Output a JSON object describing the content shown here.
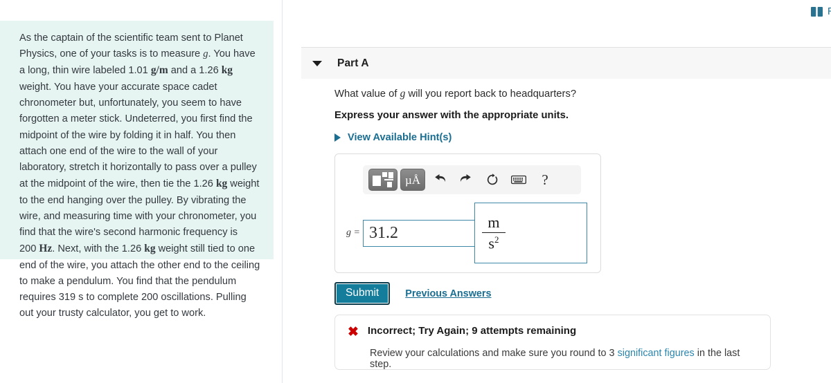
{
  "topbar": {
    "review_label": "Re",
    "review_icon": "book-icon"
  },
  "problem": {
    "paragraph": "As the captain of the scientific team sent to Planet Physics, one of your tasks is to measure g. You have a long, thin wire labeled 1.01 g/m and a 1.26 kg weight. You have your accurate space cadet chronometer but, unfortunately, you seem to have forgotten a meter stick. Undeterred, you first find the midpoint of the wire by folding it in half. You then attach one end of the wire to the wall of your laboratory, stretch it horizontally to pass over a pulley at the midpoint of the wire, then tie the 1.26 kg weight to the end hanging over the pulley. By vibrating the wire, and measuring time with your chronometer, you find that the wire's second harmonic frequency is 200 Hz. Next, with the 1.26 kg weight still tied to one end of the wire, you attach the other end to the ceiling to make a pendulum. You find that the pendulum requires 319 s to complete 200 oscillations. Pulling out your trusty calculator, you get to work.",
    "background_color": "#e6f4f2",
    "values": {
      "linear_density": "1.01 g/m",
      "mass": "1.26 kg",
      "second_harmonic": "200 Hz",
      "pendulum_time": "319 s",
      "oscillations": "200"
    }
  },
  "part": {
    "title": "Part A",
    "caret_icon": "chevron-down-icon",
    "question": "What value of g will you report back to headquarters?",
    "instruction": "Express your answer with the appropriate units.",
    "hint_label": "View Available Hint(s)",
    "hint_icon": "chevron-right-icon"
  },
  "answer": {
    "variable_label": "g =",
    "value": "31.2",
    "units": {
      "numerator": "m",
      "denominator": "s",
      "denominator_exponent": "2"
    },
    "border_color": "#3f87a6",
    "toolbar": [
      {
        "name": "template-icon",
        "label": ""
      },
      {
        "name": "units-icon",
        "label": "µÅ"
      },
      {
        "name": "undo-icon",
        "label": ""
      },
      {
        "name": "redo-icon",
        "label": ""
      },
      {
        "name": "reset-icon",
        "label": ""
      },
      {
        "name": "keyboard-icon",
        "label": ""
      },
      {
        "name": "help-icon",
        "label": "?"
      }
    ]
  },
  "actions": {
    "submit_label": "Submit",
    "previous_answers_label": "Previous Answers",
    "submit_color": "#157d9c"
  },
  "feedback": {
    "icon": "x-mark-icon",
    "icon_color": "#cc0000",
    "title": "Incorrect; Try Again; 9 attempts remaining",
    "body_pre": "Review your calculations and make sure you round to 3 ",
    "body_link": "significant figures",
    "body_post": " in the last step.",
    "attempts_remaining": 9,
    "significant_figures": 3
  }
}
